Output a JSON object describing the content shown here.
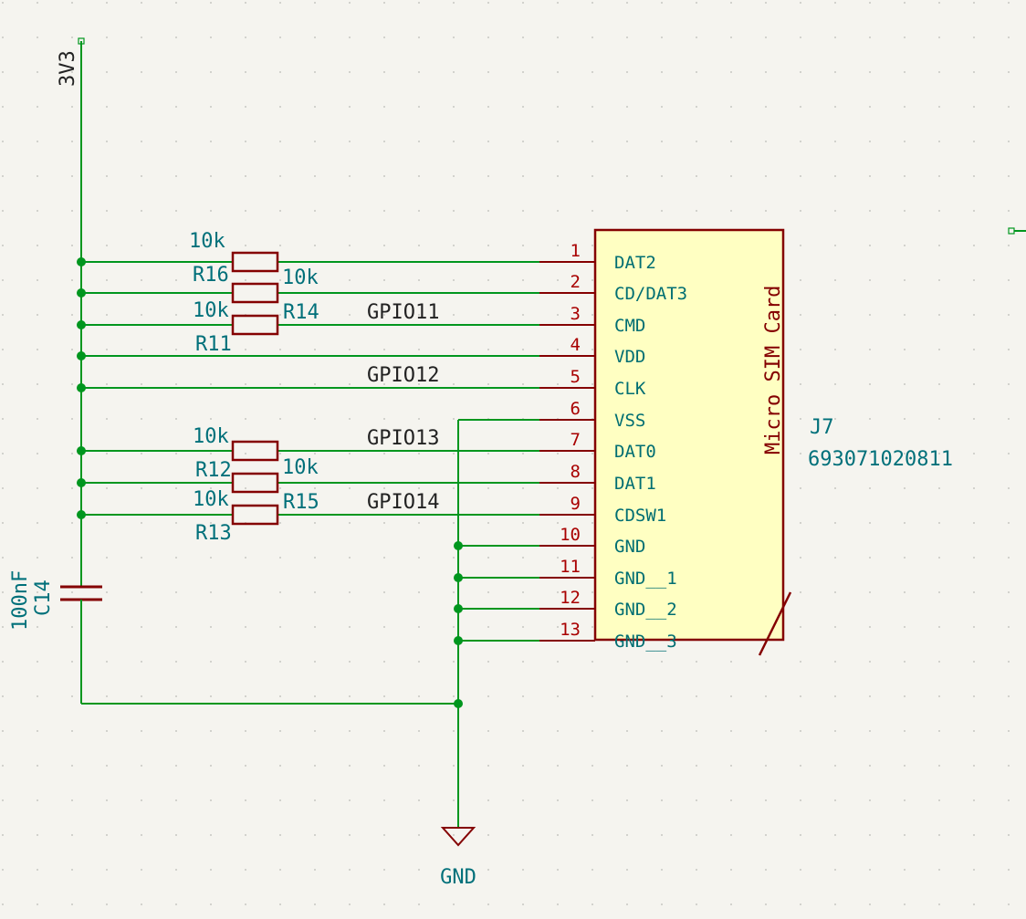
{
  "power": {
    "net_3v3": "3V3",
    "net_gnd": "GND"
  },
  "resistors": [
    {
      "ref": "R16",
      "value": "10k"
    },
    {
      "ref": "R14",
      "value": "10k"
    },
    {
      "ref": "R11",
      "value": "10k"
    },
    {
      "ref": "R12",
      "value": "10k"
    },
    {
      "ref": "R15",
      "value": "10k"
    },
    {
      "ref": "R13",
      "value": "10k"
    }
  ],
  "capacitor": {
    "ref": "C14",
    "value": "100nF"
  },
  "net_labels": [
    "GPIO11",
    "GPIO12",
    "GPIO13",
    "GPIO14"
  ],
  "connector": {
    "ref": "J7",
    "part_number": "693071020811",
    "value": "Micro SIM Card",
    "pins": [
      {
        "num": "1",
        "name": "DAT2"
      },
      {
        "num": "2",
        "name": "CD/DAT3"
      },
      {
        "num": "3",
        "name": "CMD"
      },
      {
        "num": "4",
        "name": "VDD"
      },
      {
        "num": "5",
        "name": "CLK"
      },
      {
        "num": "6",
        "name": "VSS"
      },
      {
        "num": "7",
        "name": "DAT0"
      },
      {
        "num": "8",
        "name": "DAT1"
      },
      {
        "num": "9",
        "name": "CDSW1"
      },
      {
        "num": "10",
        "name": "GND"
      },
      {
        "num": "11",
        "name": "GND__1"
      },
      {
        "num": "12",
        "name": "GND__2"
      },
      {
        "num": "13",
        "name": "GND__3"
      }
    ]
  },
  "colors": {
    "background": "#f5f4ef",
    "wire": "#00961e",
    "component": "#840000",
    "component_fill": "#ffffc2",
    "label": "#00707a"
  }
}
